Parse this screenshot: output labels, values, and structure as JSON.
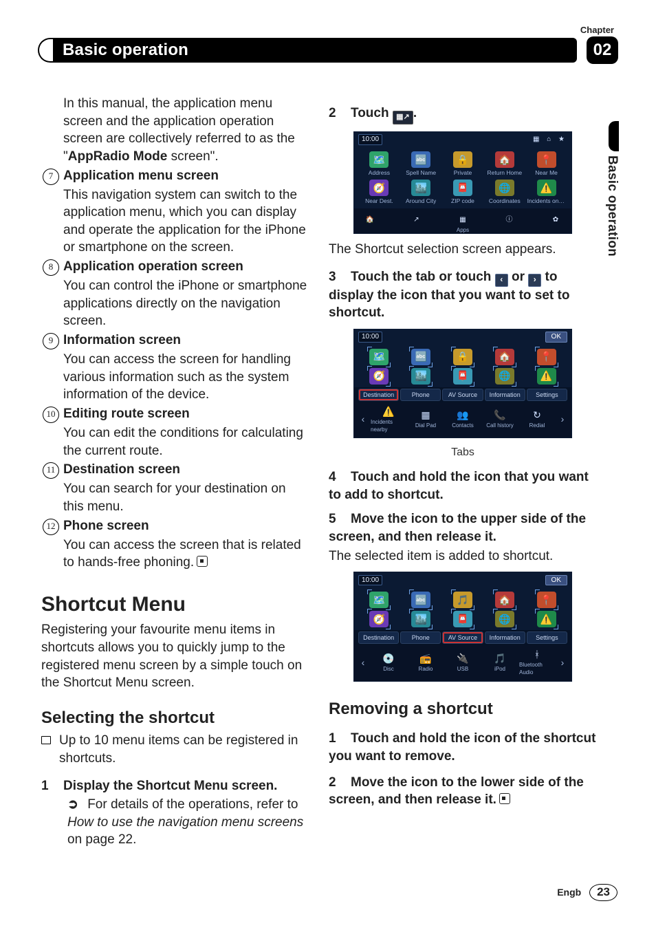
{
  "header": {
    "chapter_label": "Chapter",
    "title": "Basic operation",
    "chapter_number": "02",
    "side_label": "Basic operation"
  },
  "left_column": {
    "intro_a": "In this manual, the application menu screen and the application operation screen are collectively referred to as the \"",
    "intro_bold": "AppRadio Mode",
    "intro_b": " screen\".",
    "items": [
      {
        "num": "7",
        "title": "Application menu screen",
        "body": "This navigation system can switch to the application menu, which you can display and operate the application for the iPhone or smartphone on the screen."
      },
      {
        "num": "8",
        "title": "Application operation screen",
        "body": "You can control the iPhone or smartphone applications directly on the navigation screen."
      },
      {
        "num": "9",
        "title": "Information screen",
        "body": "You can access the screen for handling various information such as the system information of the device."
      },
      {
        "num": "10",
        "title": "Editing route screen",
        "body": "You can edit the conditions for calculating the current route."
      },
      {
        "num": "11",
        "title": "Destination screen",
        "body": "You can search for your destination on this menu."
      },
      {
        "num": "12",
        "title": "Phone screen",
        "body": "You can access the screen that is related to hands-free phoning."
      }
    ],
    "shortcut_heading": "Shortcut Menu",
    "shortcut_intro": "Registering your favourite menu items in shortcuts allows you to quickly jump to the registered menu screen by a simple touch on the Shortcut Menu screen.",
    "selecting_heading": "Selecting the shortcut",
    "selecting_bullet": "Up to 10 menu items can be registered in shortcuts.",
    "step1_title": "Display the Shortcut Menu screen.",
    "step1_num": "1",
    "step1_note_a": "For details of the operations, refer to ",
    "step1_note_italic": "How to use the navigation menu screens",
    "step1_note_b": " on page 22."
  },
  "right_column": {
    "step2_num": "2",
    "step2_title": "Touch",
    "step2_period": ".",
    "shot1_caption": "The Shortcut selection screen appears.",
    "step3_num": "3",
    "step3_a": "Touch the tab or touch ",
    "step3_b": " or ",
    "step3_c": " to display the icon that you want to set to shortcut.",
    "tabs_caption": "Tabs",
    "step4_num": "4",
    "step4_text": "Touch and hold the icon that you want to add to shortcut.",
    "step5_num": "5",
    "step5_text": "Move the icon to the upper side of the screen, and then release it.",
    "step5_after": "The selected item is added to shortcut.",
    "removing_heading": "Removing a shortcut",
    "r1_num": "1",
    "r1_text": "Touch and hold the icon of the shortcut you want to remove.",
    "r2_num": "2",
    "r2_text": "Move the icon to the lower side of the screen, and then release it."
  },
  "screens": {
    "clock": "10:00",
    "ok": "OK",
    "dest_grid": [
      "Address",
      "Spell Name",
      "Private",
      "Return Home",
      "Near Me",
      "Near Dest.",
      "Around City",
      "ZIP code",
      "Coordinates",
      "Incidents on ro..."
    ],
    "dest_icons": [
      "🗺️",
      "🔤",
      "🔒",
      "🏠",
      "📍",
      "🧭",
      "🏙️",
      "📮",
      "🌐",
      "⚠️"
    ],
    "dock1": [
      "🏠",
      "↗",
      "▦",
      "ⓘ",
      "✿"
    ],
    "dock1_center_label": "Apps",
    "tabs": [
      "Destination",
      "Phone",
      "AV Source",
      "Information",
      "Settings"
    ],
    "phone_row": [
      "Incidents nearby",
      "Dial Pad",
      "Contacts",
      "Call history",
      "Redial"
    ],
    "phone_icons": [
      "⚠️",
      "▦",
      "👥",
      "📞",
      "↻"
    ],
    "av_row": [
      "Disc",
      "Radio",
      "USB",
      "iPod",
      "Bluetooth Audio"
    ],
    "av_icons": [
      "💿",
      "📻",
      "🔌",
      "🎵",
      "ᚼ"
    ]
  },
  "footer": {
    "lang": "Engb",
    "page": "23"
  }
}
